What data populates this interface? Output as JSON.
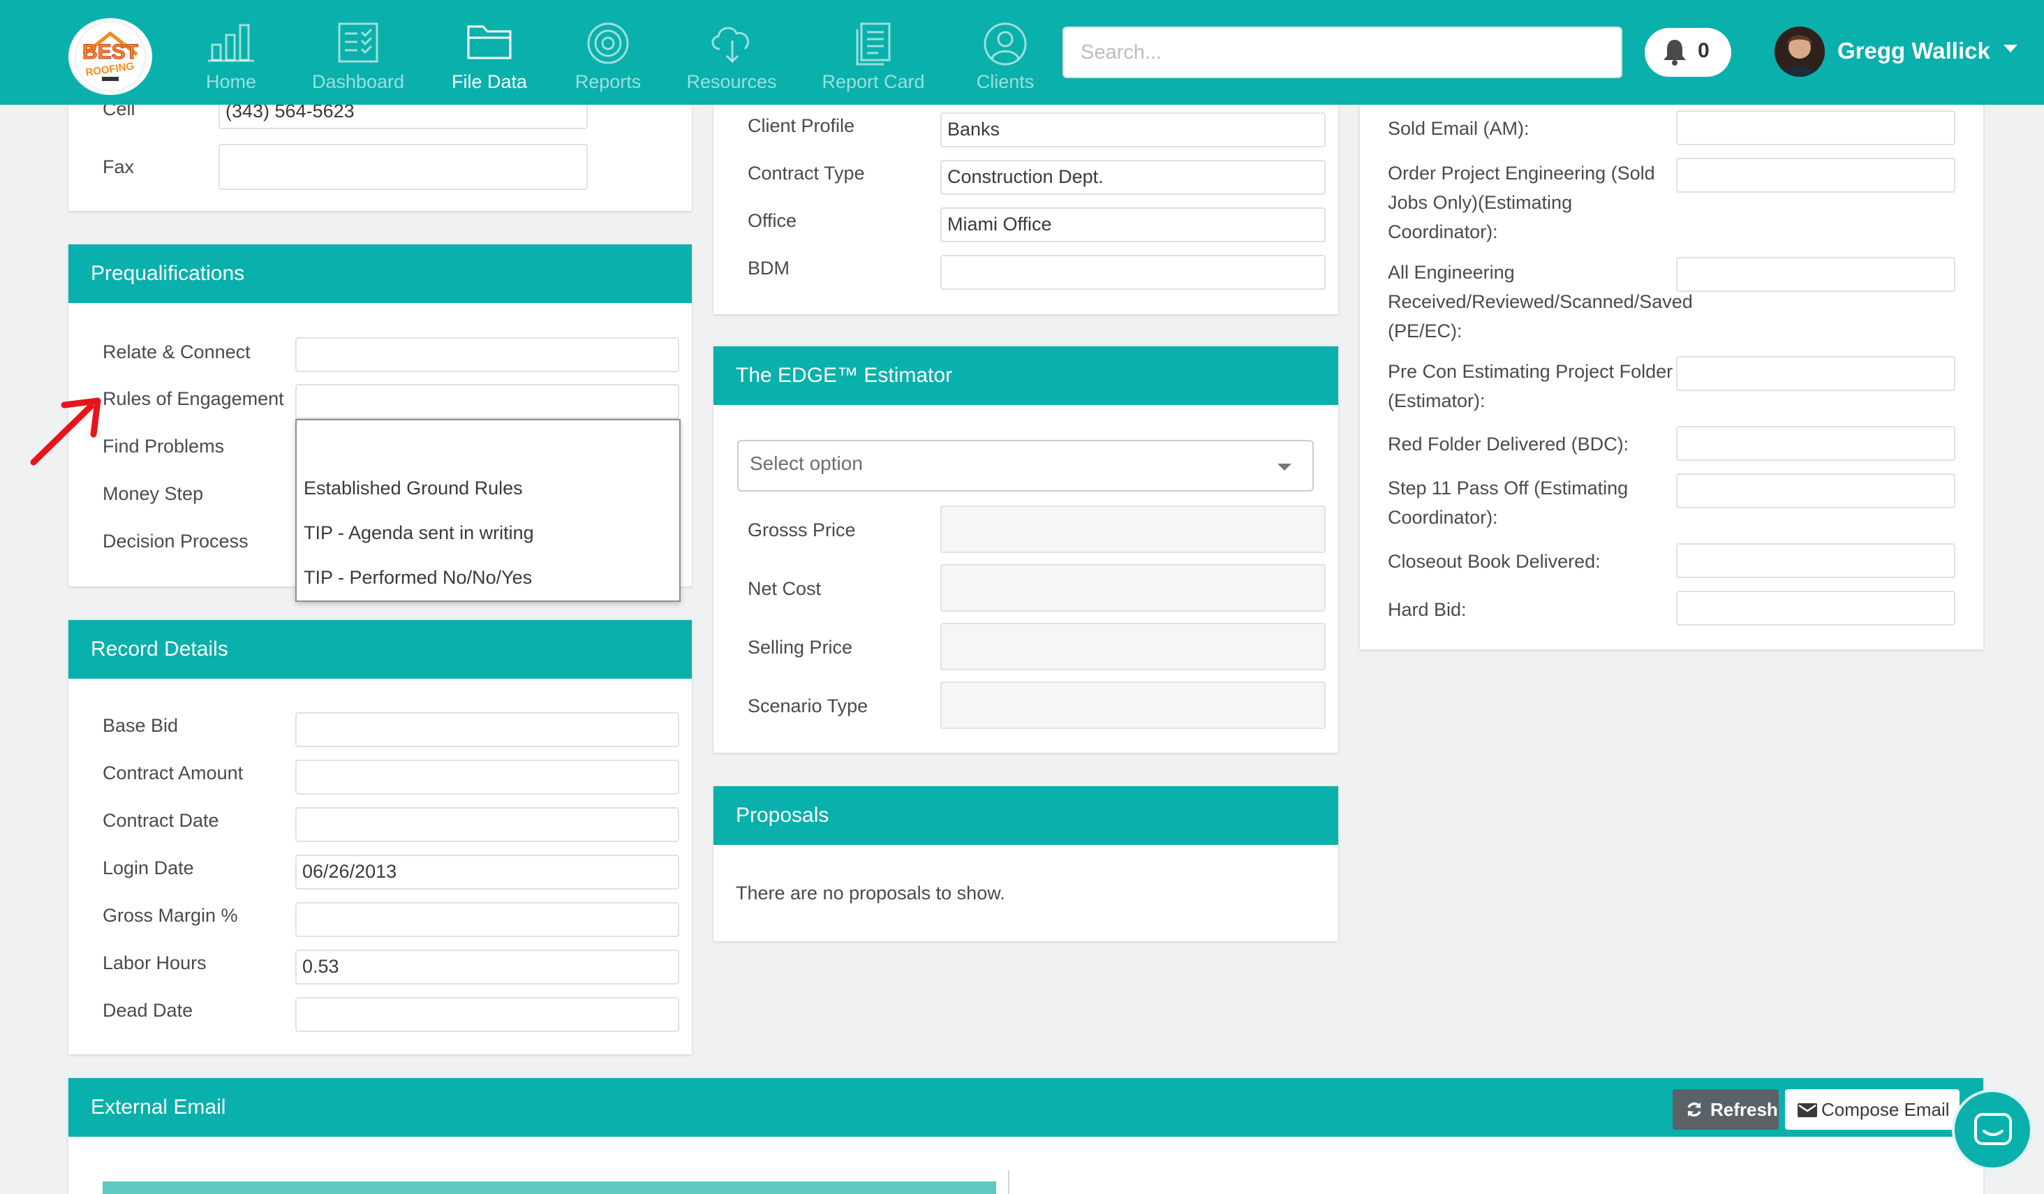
{
  "nav": {
    "logo_text": "BEST ROOFING",
    "items": [
      {
        "label": "Home",
        "icon": "bar-chart-icon"
      },
      {
        "label": "Dashboard",
        "icon": "checklist-icon"
      },
      {
        "label": "File Data",
        "icon": "folder-icon"
      },
      {
        "label": "Reports",
        "icon": "target-icon"
      },
      {
        "label": "Resources",
        "icon": "cloud-download-icon"
      },
      {
        "label": "Report Card",
        "icon": "document-icon"
      },
      {
        "label": "Clients",
        "icon": "user-icon"
      }
    ],
    "active": "File Data",
    "search_placeholder": "Search...",
    "notification_count": "0",
    "user_name": "Gregg Wallick"
  },
  "contact": {
    "cell_label": "Cell",
    "cell_value": "(343) 564-5623",
    "fax_label": "Fax",
    "fax_value": ""
  },
  "prequalifications": {
    "title": "Prequalifications",
    "fields": [
      {
        "label": "Relate & Connect",
        "value": ""
      },
      {
        "label": "Rules of Engagement",
        "value": ""
      },
      {
        "label": "Find Problems",
        "value": ""
      },
      {
        "label": "Money Step",
        "value": ""
      },
      {
        "label": "Decision Process",
        "value": ""
      }
    ],
    "dropdown_options": [
      "",
      "Established Ground Rules",
      "TIP - Agenda sent in writing",
      "TIP - Performed No/No/Yes"
    ]
  },
  "record_details": {
    "title": "Record Details",
    "fields": [
      {
        "label": "Base Bid",
        "value": ""
      },
      {
        "label": "Contract Amount",
        "value": ""
      },
      {
        "label": "Contract Date",
        "value": ""
      },
      {
        "label": "Login Date",
        "value": "06/26/2013"
      },
      {
        "label": "Gross Margin %",
        "value": ""
      },
      {
        "label": "Labor Hours",
        "value": "0.53"
      },
      {
        "label": "Dead Date",
        "value": ""
      }
    ]
  },
  "profile": {
    "fields": [
      {
        "label": "Client Profile",
        "value": "Banks"
      },
      {
        "label": "Contract Type",
        "value": "Construction Dept."
      },
      {
        "label": "Office",
        "value": "Miami Office"
      },
      {
        "label": "BDM",
        "value": ""
      }
    ]
  },
  "estimator": {
    "title": "The EDGE™ Estimator",
    "select_placeholder": "Select option",
    "fields": [
      {
        "label": "Grosss Price",
        "value": ""
      },
      {
        "label": "Net Cost",
        "value": ""
      },
      {
        "label": "Selling Price",
        "value": ""
      },
      {
        "label": "Scenario Type",
        "value": ""
      }
    ]
  },
  "proposals": {
    "title": "Proposals",
    "empty_text": "There are no proposals to show."
  },
  "milestones": {
    "fields": [
      {
        "label": "Sold Email (AM):",
        "value": ""
      },
      {
        "label": "Order Project Engineering (Sold Jobs Only)(Estimating Coordinator):",
        "value": ""
      },
      {
        "label": "All Engineering Received/Reviewed/Scanned/Saved (PE/EC):",
        "value": ""
      },
      {
        "label": "Pre Con Estimating Project Folder (Estimator):",
        "value": ""
      },
      {
        "label": "Red Folder Delivered (BDC):",
        "value": ""
      },
      {
        "label": "Step 11 Pass Off (Estimating Coordinator):",
        "value": ""
      },
      {
        "label": "Closeout Book Delivered:",
        "value": ""
      },
      {
        "label": "Hard Bid:",
        "value": ""
      }
    ]
  },
  "external_email": {
    "title": "External Email",
    "refresh_label": "Refresh",
    "compose_label": "Compose Email"
  },
  "colors": {
    "brand": "#0ab0ab",
    "annotation_arrow": "#e8141b",
    "dark_button": "#5a6268"
  }
}
